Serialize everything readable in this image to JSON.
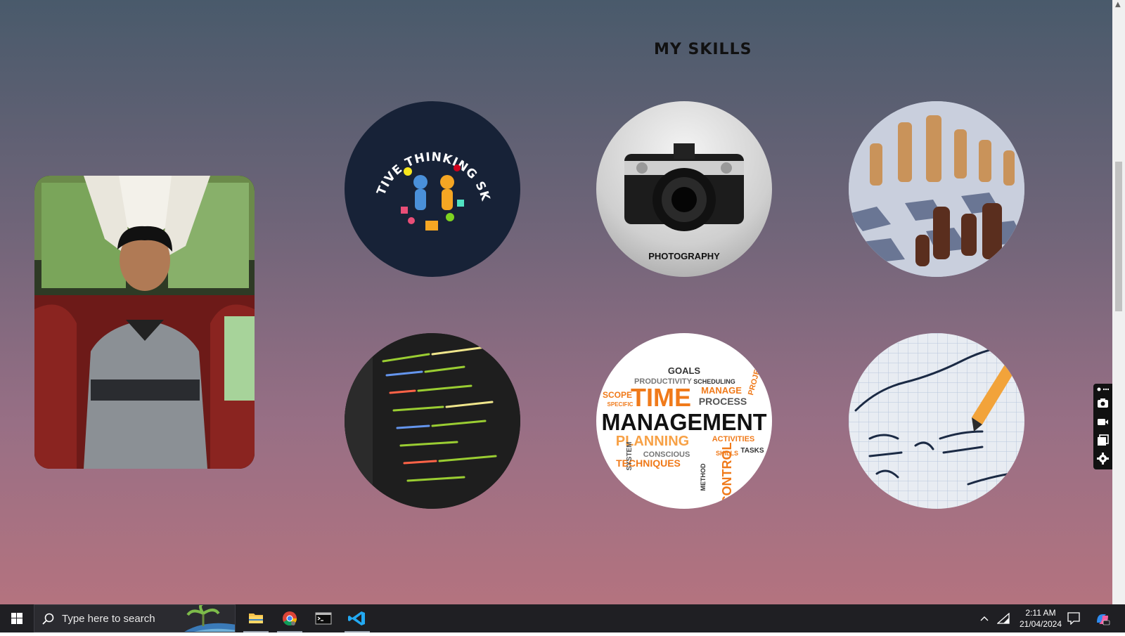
{
  "skills_section": {
    "title": "MY SKILLS",
    "cards": [
      {
        "name": "creative-thinking",
        "text": "CREATIVE THINKING SKILLS"
      },
      {
        "name": "photography",
        "text": "PHOTOGRAPHY"
      },
      {
        "name": "chess",
        "text": ""
      },
      {
        "name": "programming",
        "text": ""
      },
      {
        "name": "time-management",
        "words": {
          "goals": "GOALS",
          "productivity": "PRODUCTIVITY",
          "scheduling": "SCHEDULING",
          "time": "TIME",
          "manage": "MANAGE",
          "process": "PROCESS",
          "management": "MANAGEMENT",
          "planning": "PLANNING",
          "activities": "ACTIVITIES",
          "conscious": "CONSCIOUS",
          "techniques": "TECHNIQUES",
          "control": "CONTROL",
          "skills": "SKILLS",
          "tasks": "TASKS",
          "scope": "SCOPE",
          "specific": "SPECIFIC",
          "system": "SYSTEM",
          "method": "METHOD",
          "project": "PROJECT"
        }
      },
      {
        "name": "mathematics",
        "text": ""
      }
    ]
  },
  "taskbar": {
    "search_placeholder": "Type here to search",
    "time": "2:11 AM",
    "date": "21/04/2024",
    "apps": [
      "file-explorer",
      "chrome",
      "terminal",
      "vscode"
    ]
  },
  "colors": {
    "gradient_top": "#495a6b",
    "gradient_bottom": "#b4737f",
    "taskbar": "#1f1f23"
  }
}
